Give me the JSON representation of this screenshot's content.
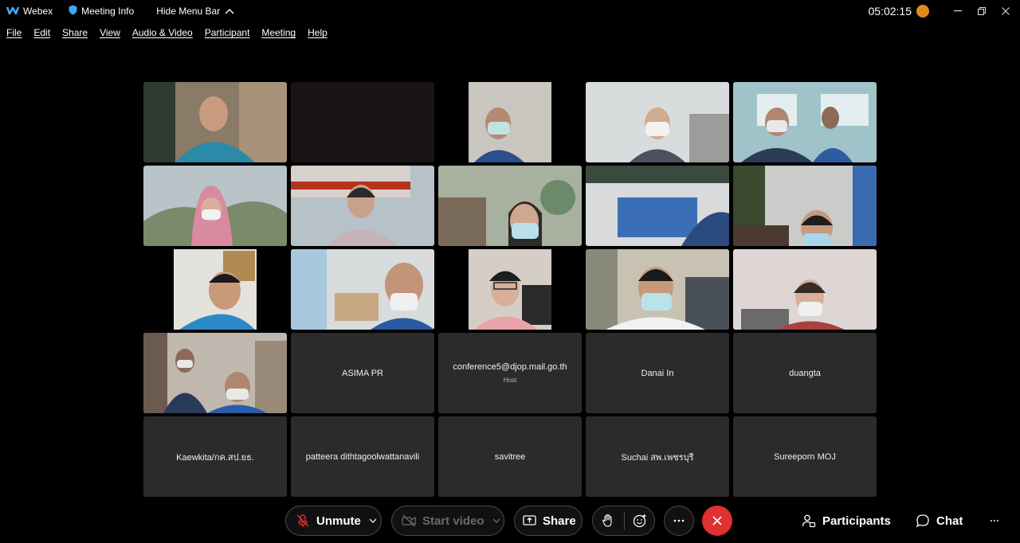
{
  "titlebar": {
    "app_name": "Webex",
    "meeting_info": "Meeting Info",
    "hide_menu_bar": "Hide Menu Bar",
    "clock": "05:02:15"
  },
  "menu": [
    "File",
    "Edit",
    "Share",
    "View",
    "Audio & Video",
    "Participant",
    "Meeting",
    "Help"
  ],
  "participants_video_count": 16,
  "name_tiles": [
    {
      "name": "ASIMA PR",
      "sub": ""
    },
    {
      "name": "conference5@djop.mail.go.th",
      "sub": "Host"
    },
    {
      "name": "Danai In",
      "sub": ""
    },
    {
      "name": "duangta",
      "sub": ""
    },
    {
      "name": "Kaewkita/กค.สป.ยธ.",
      "sub": ""
    },
    {
      "name": "patteera dithtagoolwattanavili",
      "sub": ""
    },
    {
      "name": "savitree",
      "sub": ""
    },
    {
      "name": "Suchai สพ.เพชรบุรี",
      "sub": ""
    },
    {
      "name": "Sureeporn MOJ",
      "sub": ""
    }
  ],
  "toolbar": {
    "unmute_label": "Unmute",
    "start_video_label": "Start video",
    "share_label": "Share",
    "participants_label": "Participants",
    "chat_label": "Chat"
  },
  "colors": {
    "end_meeting": "#e0302f",
    "status_badge": "#e08a1e",
    "tile_bg": "#2b2b2b"
  }
}
